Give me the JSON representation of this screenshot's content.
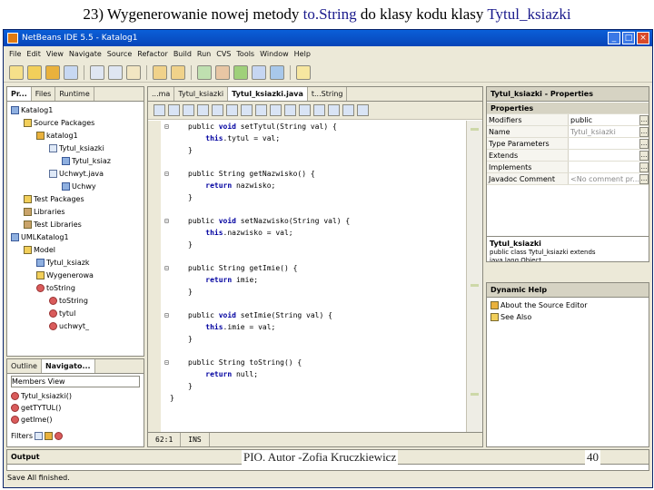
{
  "slide": {
    "title_prefix": "23) Wygenerowanie nowej  metody ",
    "title_method": "to.String",
    "title_middle": " do klasy kodu klasy ",
    "title_class": "Tytul_ksiazki",
    "footer_author": "PIO.  Autor -Zofia Kruczkiewicz",
    "page_number": "40"
  },
  "window": {
    "title": "NetBeans IDE 5.5 - Katalog1",
    "buttons": [
      "_",
      "□",
      "×"
    ]
  },
  "menu": [
    "File",
    "Edit",
    "View",
    "Navigate",
    "Source",
    "Refactor",
    "Build",
    "Run",
    "CVS",
    "Tools",
    "Window",
    "Help"
  ],
  "projects_panel": {
    "tabs": [
      "Pr...",
      "Files",
      "Runtime"
    ],
    "tree": [
      {
        "label": "Katalog1",
        "icon": "project-icon"
      },
      {
        "label": "Source Packages",
        "icon": "folder-icon"
      },
      {
        "label": "katalog1",
        "icon": "package-icon"
      },
      {
        "label": "Tytul_ksiazki",
        "icon": "java-file-icon"
      },
      {
        "label": "Tytul_ksiaz",
        "icon": "class-icon"
      },
      {
        "label": "Uchwyt.java",
        "icon": "java-file-icon"
      },
      {
        "label": "Uchwy",
        "icon": "class-icon"
      },
      {
        "label": "Test Packages",
        "icon": "folder-icon"
      },
      {
        "label": "Libraries",
        "icon": "library-icon"
      },
      {
        "label": "Test Libraries",
        "icon": "library-icon"
      },
      {
        "label": "UMLKatalog1",
        "icon": "uml-project-icon"
      },
      {
        "label": "Model",
        "icon": "folder-icon"
      },
      {
        "label": "Tytul_ksiazk",
        "icon": "class-icon"
      },
      {
        "label": "Wygenerowa",
        "icon": "folder-icon"
      },
      {
        "label": "toString",
        "icon": "method-icon"
      },
      {
        "label": "toString",
        "icon": "method-icon"
      },
      {
        "label": "tytul",
        "icon": "method-icon"
      },
      {
        "label": "uchwyt_",
        "icon": "method-icon"
      }
    ]
  },
  "outline_panel": {
    "tabs": [
      "Outline",
      "Navigato..."
    ],
    "filter_label": "Members View",
    "members": [
      "Tytul_ksiazki()",
      "getTYTUL()",
      "getIme()"
    ],
    "filters_label": "Filters"
  },
  "editor": {
    "tabs": [
      "...ma",
      "Tytul_ksiazki",
      "Tytul_ksiazki.java",
      "t...String"
    ],
    "code_lines": [
      {
        "pre": "public ",
        "kw": "void",
        "post": " setTytul(String val) {"
      },
      {
        "pre": "    ",
        "kw": "this",
        "post": ".tytul = val;"
      },
      {
        "pre": "}",
        "kw": "",
        "post": ""
      },
      {
        "pre": "",
        "kw": "",
        "post": ""
      },
      {
        "pre": "public String getNazwisko() {",
        "kw": "",
        "post": ""
      },
      {
        "pre": "    ",
        "kw": "return",
        "post": " nazwisko;"
      },
      {
        "pre": "}",
        "kw": "",
        "post": ""
      },
      {
        "pre": "",
        "kw": "",
        "post": ""
      },
      {
        "pre": "public ",
        "kw": "void",
        "post": " setNazwisko(String val) {"
      },
      {
        "pre": "    ",
        "kw": "this",
        "post": ".nazwisko = val;"
      },
      {
        "pre": "}",
        "kw": "",
        "post": ""
      },
      {
        "pre": "",
        "kw": "",
        "post": ""
      },
      {
        "pre": "public String getImie() {",
        "kw": "",
        "post": ""
      },
      {
        "pre": "    ",
        "kw": "return",
        "post": " imie;"
      },
      {
        "pre": "}",
        "kw": "",
        "post": ""
      },
      {
        "pre": "",
        "kw": "",
        "post": ""
      },
      {
        "pre": "public ",
        "kw": "void",
        "post": " setImie(String val) {"
      },
      {
        "pre": "    ",
        "kw": "this",
        "post": ".imie = val;"
      },
      {
        "pre": "}",
        "kw": "",
        "post": ""
      },
      {
        "pre": "",
        "kw": "",
        "post": ""
      },
      {
        "pre": "public String toString() {",
        "kw": "",
        "post": ""
      },
      {
        "pre": "    ",
        "kw": "return",
        "post": " null;"
      },
      {
        "pre": "}",
        "kw": "",
        "post": ""
      },
      {
        "pre": "}",
        "kw": "",
        "post": ""
      }
    ],
    "status_position": "62:1",
    "status_mode": "INS"
  },
  "properties_panel": {
    "title": "Tytul_ksiazki - Properties",
    "section": "Properties",
    "rows": [
      {
        "key": "Modifiers",
        "value": "public"
      },
      {
        "key": "Name",
        "value": "Tytul_ksiazki"
      },
      {
        "key": "Type Parameters",
        "value": ""
      },
      {
        "key": "Extends",
        "value": ""
      },
      {
        "key": "Implements",
        "value": ""
      },
      {
        "key": "Javadoc Comment",
        "value": "<No comment pr..."
      }
    ],
    "desc_title": "Tytul_ksiazki",
    "desc_text": "public class Tytul_ksiazki extends java.lang.Object"
  },
  "help_panel": {
    "title": "Dynamic Help",
    "items": [
      "About the Source Editor",
      "See Also"
    ]
  },
  "output_panel": {
    "title": "Output"
  },
  "status": {
    "message": "Save All finished."
  }
}
